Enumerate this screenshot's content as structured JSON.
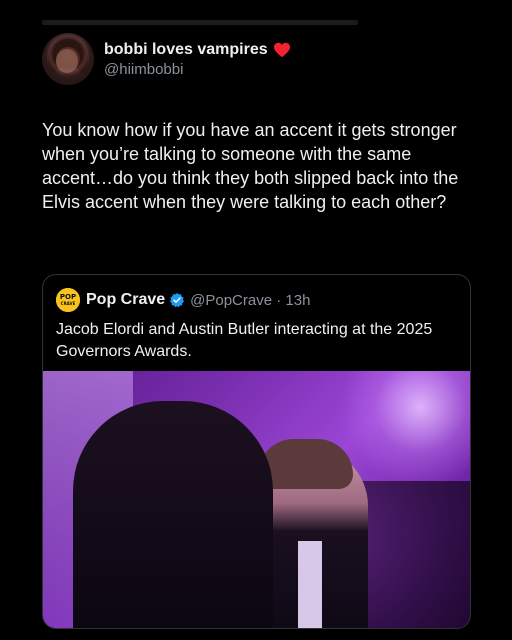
{
  "tweet": {
    "display_name": "bobbi loves vampires",
    "name_emoji": "red-heart-icon",
    "handle": "@hiimbobbi",
    "text": "You know how if you have an accent it gets stronger when you’re talking to someone with the same accent…do you  think they both slipped back into the Elvis accent when they were talking to each other?"
  },
  "quote": {
    "logo_text": "POP CRAVE",
    "display_name": "Pop Crave",
    "verified": true,
    "handle_time": "@PopCrave · 13h",
    "text": "Jacob Elordi and Austin Butler interacting at the 2025 Governors Awards.",
    "media": "photo"
  },
  "colors": {
    "background": "#000000",
    "text": "#f0f0f0",
    "secondary_text": "#8b9299",
    "verified_blue": "#1d9bf0",
    "heart_red": "#f4222f",
    "logo_yellow": "#f7c31c"
  }
}
